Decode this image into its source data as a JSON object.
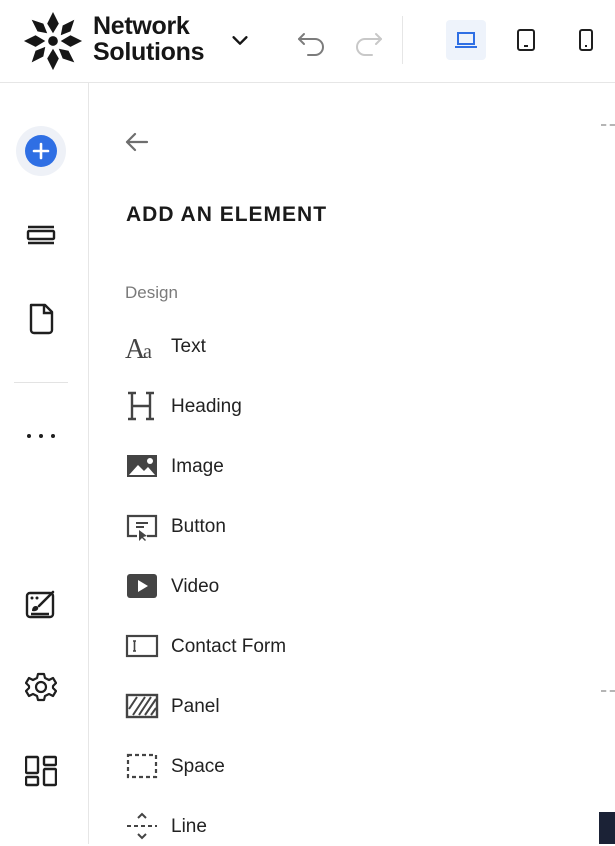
{
  "header": {
    "logo_line1": "Network",
    "logo_line2": "Solutions",
    "icons": [
      "logo-mark",
      "chevron-down-icon",
      "undo-icon",
      "redo-icon",
      "desktop-icon",
      "tablet-icon",
      "mobile-icon"
    ],
    "active_device": "desktop"
  },
  "rail": {
    "icons": [
      "plus-icon",
      "sections-icon",
      "page-icon",
      "more-icon",
      "design-icon",
      "gear-icon",
      "apps-icon"
    ]
  },
  "panel": {
    "title": "ADD AN ELEMENT",
    "section": "Design",
    "elements": [
      {
        "label": "Text",
        "icon": "text-icon"
      },
      {
        "label": "Heading",
        "icon": "heading-icon"
      },
      {
        "label": "Image",
        "icon": "image-icon"
      },
      {
        "label": "Button",
        "icon": "button-icon"
      },
      {
        "label": "Video",
        "icon": "video-icon"
      },
      {
        "label": "Contact Form",
        "icon": "contact-form-icon"
      },
      {
        "label": "Panel",
        "icon": "panel-icon"
      },
      {
        "label": "Space",
        "icon": "space-icon"
      },
      {
        "label": "Line",
        "icon": "line-icon"
      }
    ]
  },
  "colors": {
    "accent": "#2f6fe4",
    "add_button_bg": "#2f6fe4",
    "active_device_bg": "#eef3fb",
    "icon_dark": "#1f1f1f",
    "muted": "#7a7a7a"
  }
}
